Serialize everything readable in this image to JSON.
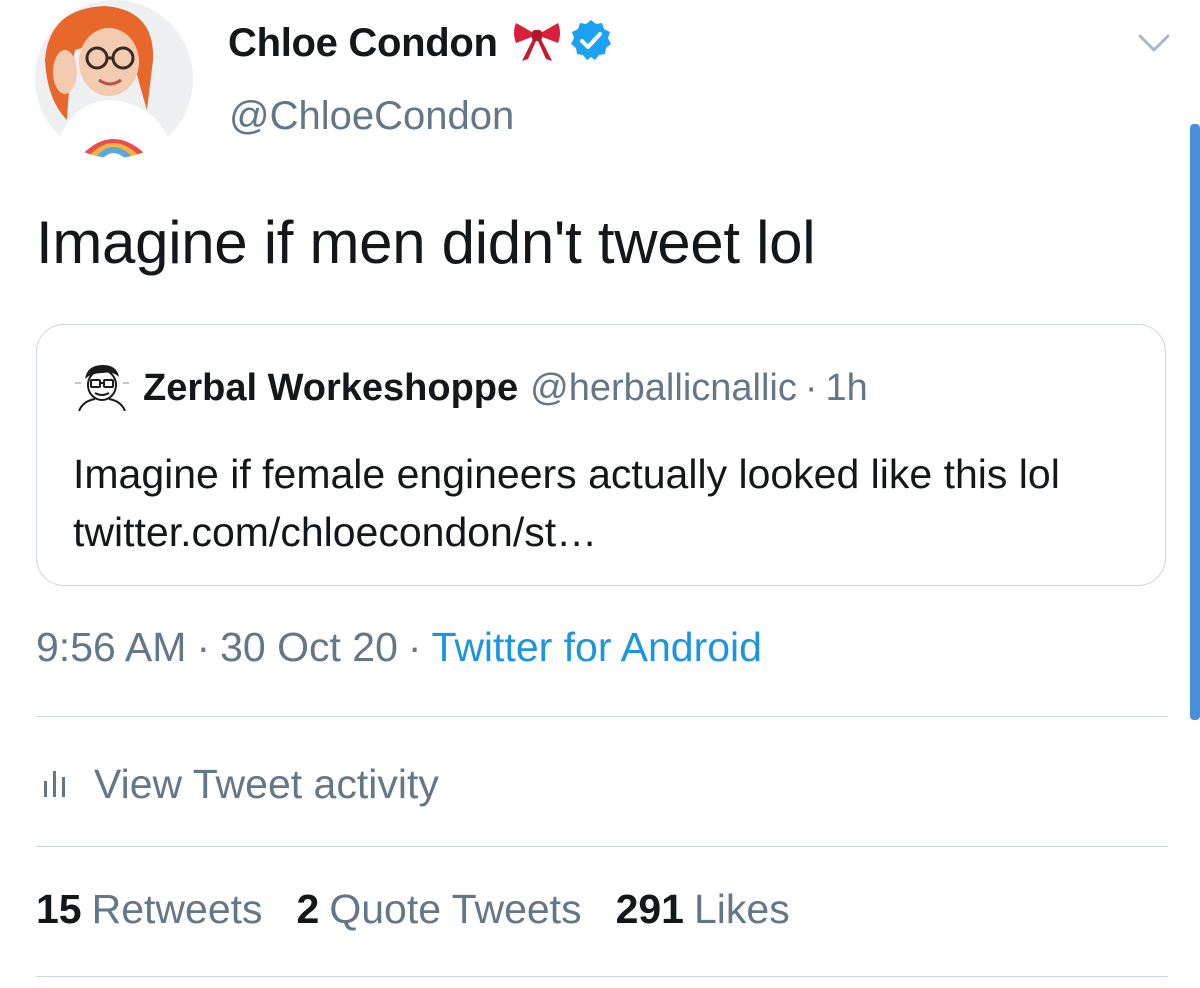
{
  "tweet": {
    "author": {
      "display_name": "Chloe Condon",
      "handle": "@ChloeCondon",
      "badges": [
        "bow-emoji",
        "verified-badge"
      ]
    },
    "text": "Imagine if men didn't tweet lol",
    "quoted": {
      "display_name": "Zerbal Workeshoppe",
      "handle": "@herballicnallic",
      "separator": "·",
      "time": "1h",
      "text": "Imagine if female engineers actually looked like this lol twitter.com/chloecondon/st…"
    },
    "meta": {
      "time": "9:56 AM",
      "separator": "·",
      "date": "30 Oct 20",
      "source": "Twitter for Android"
    },
    "activity_label": "View Tweet activity",
    "stats": {
      "retweets_count": "15",
      "retweets_label": "Retweets",
      "quote_count": "2",
      "quote_label": "Quote Tweets",
      "likes_count": "291",
      "likes_label": "Likes"
    }
  },
  "icons": {
    "menu": "chevron-down-icon",
    "activity": "bar-chart-icon",
    "verified": "verified-badge-icon",
    "bow": "bow-emoji-icon"
  },
  "colors": {
    "primary_text": "#14171a",
    "secondary_text": "#657786",
    "link": "#1b95e0",
    "verified": "#1da1f2",
    "border": "#ccd6dd"
  }
}
